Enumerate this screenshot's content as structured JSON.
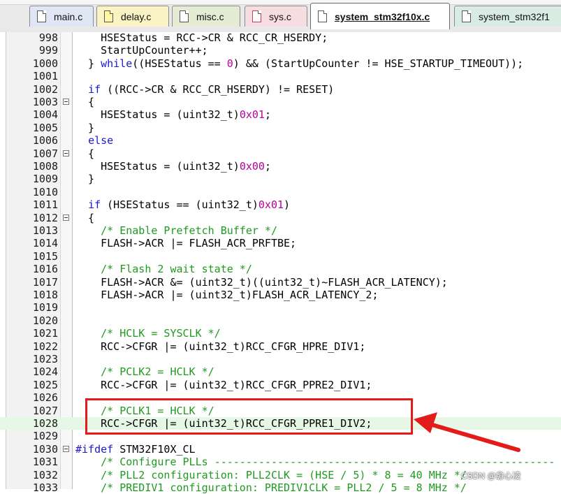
{
  "tabs": [
    {
      "label": "main.c",
      "icon": "c-file-icon",
      "active": false
    },
    {
      "label": "delay.c",
      "icon": "c-file-yellow-icon",
      "active": false
    },
    {
      "label": "misc.c",
      "icon": "c-file-icon",
      "active": false
    },
    {
      "label": "sys.c",
      "icon": "c-file-icon",
      "active": false
    },
    {
      "label": "system_stm32f10x.c",
      "icon": "c-file-icon",
      "active": true
    },
    {
      "label": "system_stm32f1",
      "icon": "c-file-icon",
      "active": false
    }
  ],
  "lines": [
    {
      "n": "998",
      "code": "    HSEStatus = RCC->CR & RCC_CR_HSERDY;",
      "fold": false
    },
    {
      "n": "999",
      "code": "    StartUpCounter++;",
      "fold": false
    },
    {
      "n": "1000",
      "code": "  } while((HSEStatus == 0) && (StartUpCounter != HSE_STARTUP_TIMEOUT));",
      "fold": false
    },
    {
      "n": "1001",
      "code": "",
      "fold": false
    },
    {
      "n": "1002",
      "code": "  if ((RCC->CR & RCC_CR_HSERDY) != RESET)",
      "fold": false
    },
    {
      "n": "1003",
      "code": "  {",
      "fold": true
    },
    {
      "n": "1004",
      "code": "    HSEStatus = (uint32_t)0x01;",
      "fold": false
    },
    {
      "n": "1005",
      "code": "  }",
      "fold": false
    },
    {
      "n": "1006",
      "code": "  else",
      "fold": false
    },
    {
      "n": "1007",
      "code": "  {",
      "fold": true
    },
    {
      "n": "1008",
      "code": "    HSEStatus = (uint32_t)0x00;",
      "fold": false
    },
    {
      "n": "1009",
      "code": "  }",
      "fold": false
    },
    {
      "n": "1010",
      "code": "",
      "fold": false
    },
    {
      "n": "1011",
      "code": "  if (HSEStatus == (uint32_t)0x01)",
      "fold": false
    },
    {
      "n": "1012",
      "code": "  {",
      "fold": true
    },
    {
      "n": "1013",
      "code": "    /* Enable Prefetch Buffer */",
      "fold": false
    },
    {
      "n": "1014",
      "code": "    FLASH->ACR |= FLASH_ACR_PRFTBE;",
      "fold": false
    },
    {
      "n": "1015",
      "code": "",
      "fold": false
    },
    {
      "n": "1016",
      "code": "    /* Flash 2 wait state */",
      "fold": false
    },
    {
      "n": "1017",
      "code": "    FLASH->ACR &= (uint32_t)((uint32_t)~FLASH_ACR_LATENCY);",
      "fold": false
    },
    {
      "n": "1018",
      "code": "    FLASH->ACR |= (uint32_t)FLASH_ACR_LATENCY_2;",
      "fold": false
    },
    {
      "n": "1019",
      "code": "",
      "fold": false
    },
    {
      "n": "1020",
      "code": "",
      "fold": false
    },
    {
      "n": "1021",
      "code": "    /* HCLK = SYSCLK */",
      "fold": false
    },
    {
      "n": "1022",
      "code": "    RCC->CFGR |= (uint32_t)RCC_CFGR_HPRE_DIV1;",
      "fold": false
    },
    {
      "n": "1023",
      "code": "",
      "fold": false
    },
    {
      "n": "1024",
      "code": "    /* PCLK2 = HCLK */",
      "fold": false
    },
    {
      "n": "1025",
      "code": "    RCC->CFGR |= (uint32_t)RCC_CFGR_PPRE2_DIV1;",
      "fold": false
    },
    {
      "n": "1026",
      "code": "",
      "fold": false
    },
    {
      "n": "1027",
      "code": "    /* PCLK1 = HCLK */",
      "fold": false
    },
    {
      "n": "1028",
      "code": "    RCC->CFGR |= (uint32_t)RCC_CFGR_PPRE1_DIV2;",
      "fold": false,
      "highlight": true
    },
    {
      "n": "1029",
      "code": "",
      "fold": false
    },
    {
      "n": "1030",
      "code": "#ifdef STM32F10X_CL",
      "fold": true
    },
    {
      "n": "1031",
      "code": "    /* Configure PLLs ------------------------------------------------------",
      "fold": false
    },
    {
      "n": "1032",
      "code": "    /* PLL2 configuration: PLL2CLK = (HSE / 5) * 8 = 40 MHz */",
      "fold": false
    },
    {
      "n": "1033",
      "code": "    /* PREDIV1 configuration: PREDIV1CLK = PLL2 / 5 = 8 MHz */",
      "fold": false
    }
  ],
  "watermark": "CSDN @愈心凌",
  "colors": {
    "keyword": "#1a1acc",
    "comment": "#1f9a1f",
    "number": "#b8009c",
    "annotation": "#e31b1b",
    "current_line": "#e6f7e6"
  }
}
